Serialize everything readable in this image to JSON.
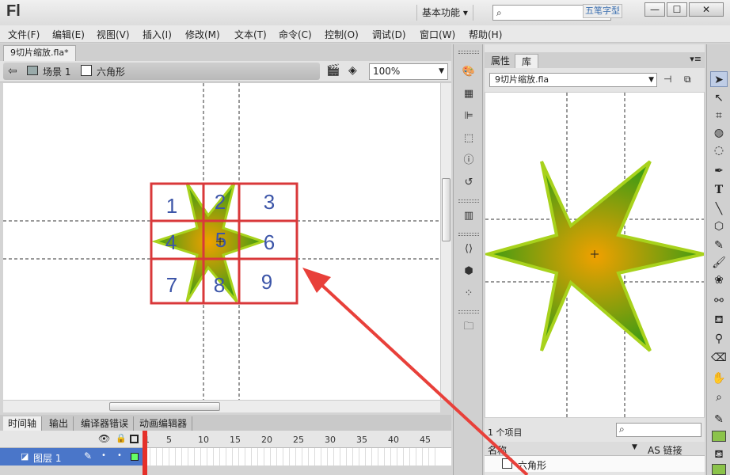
{
  "app": {
    "logo": "Fl",
    "workspace": "基本功能 ▾",
    "watermark": "五笔字型",
    "window_buttons": {
      "min": "—",
      "max": "☐",
      "close": "✕"
    }
  },
  "menu": [
    "文件(F)",
    "编辑(E)",
    "视图(V)",
    "插入(I)",
    "修改(M)",
    "文本(T)",
    "命令(C)",
    "控制(O)",
    "调试(D)",
    "窗口(W)",
    "帮助(H)"
  ],
  "document": {
    "tab": "9切片缩放.fla*",
    "scene": "场景 1",
    "symbol": "六角形",
    "zoom": "100%"
  },
  "stage": {
    "grid_numbers": [
      "1",
      "2",
      "3",
      "4",
      "5",
      "6",
      "7",
      "8",
      "9"
    ],
    "star_fill_center": "#f0a000",
    "star_fill_edge": "#3e9c14",
    "star_stroke": "#a8d21c",
    "grid_color": "#d9383a",
    "number_color": "#3c55a8"
  },
  "timeline": {
    "tabs": [
      "时间轴",
      "输出",
      "编译器错误",
      "动画编辑器"
    ],
    "frame_numbers": [
      "1",
      "5",
      "10",
      "15",
      "20",
      "25",
      "30",
      "35",
      "40",
      "45"
    ],
    "layer": "图层 1"
  },
  "library": {
    "tabs": [
      "属性",
      "库"
    ],
    "file": "9切片缩放.fla",
    "count": "1 个项目",
    "col_name": "名称",
    "col_link": "AS 链接",
    "item": "六角形"
  }
}
